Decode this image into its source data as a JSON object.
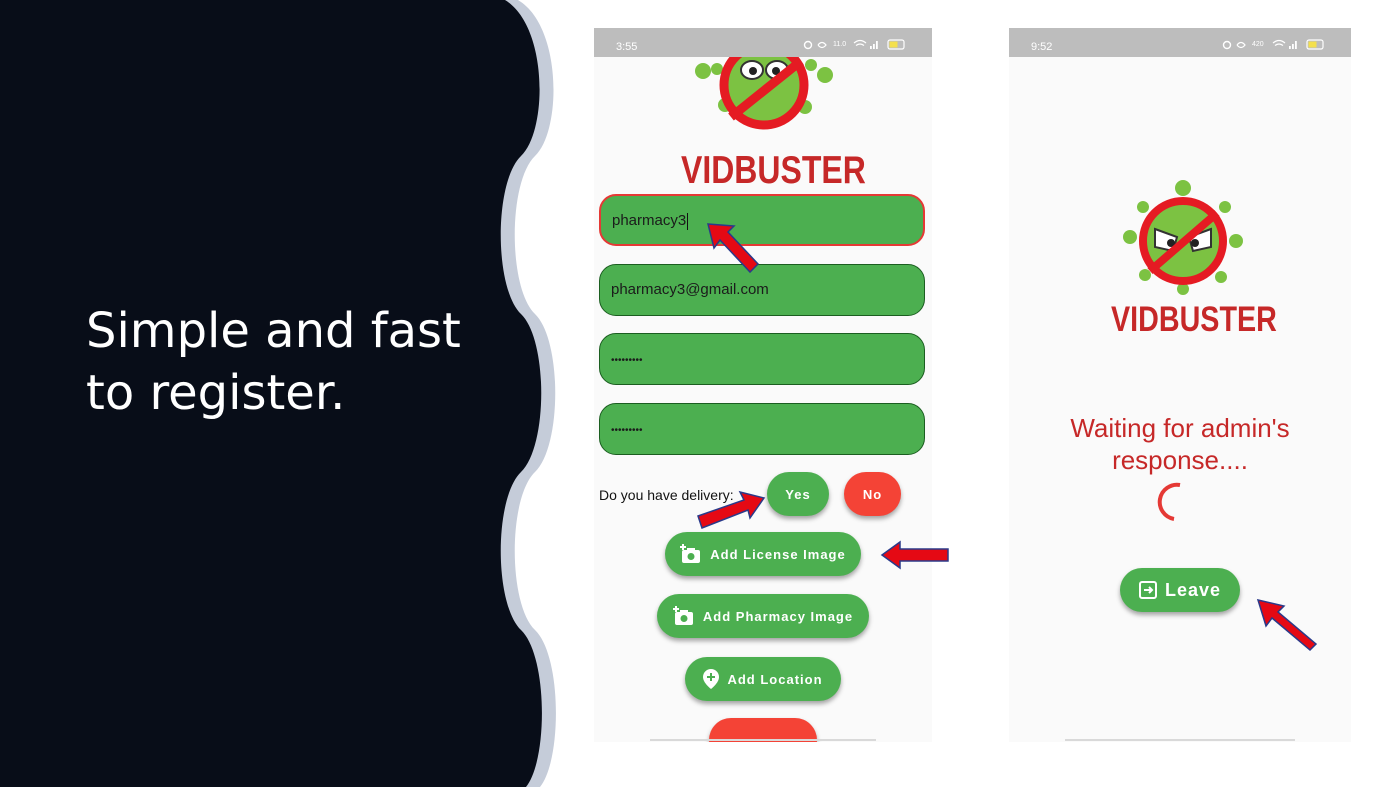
{
  "slide": {
    "headline_line1": "Simple and fast",
    "headline_line2": "to register.",
    "dark_color": "#080d18",
    "wave_color": "#c5ccd9"
  },
  "register_screen": {
    "status_time": "3:55",
    "status_net_speed": "11.0",
    "battery": "39",
    "brand": "VIDBUSTER",
    "name_value": "pharmacy3",
    "email_value": "pharmacy3@gmail.com",
    "password_mask": "•••••••••",
    "confirm_mask": "•••••••••",
    "delivery_question": "Do you have delivery:",
    "yes_label": "Yes",
    "no_label": "No",
    "license_button": "Add License Image",
    "pharmacy_button": "Add Pharmacy Image",
    "location_button": "Add Location",
    "camera_icon": "add-a-photo-icon",
    "location_icon": "add-location-icon"
  },
  "waiting_screen": {
    "status_time": "9:52",
    "status_net_speed": "420",
    "battery": "42",
    "brand": "VIDBUSTER",
    "waiting_line1": "Waiting for admin's",
    "waiting_line2": "response....",
    "leave_label": "Leave",
    "leave_icon": "exit-icon"
  },
  "colors": {
    "accent_green": "#4caf50",
    "accent_red": "#f44336",
    "brand_red": "#c62828"
  }
}
